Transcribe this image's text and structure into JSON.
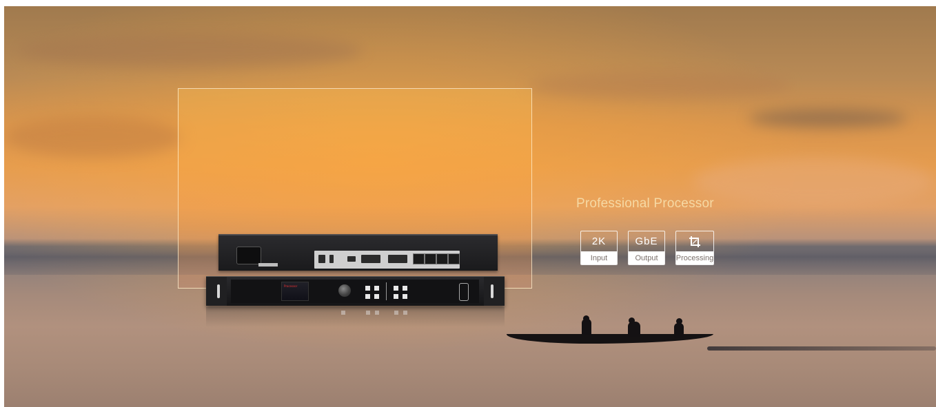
{
  "hero": {
    "headline": "Professional Processor",
    "features": [
      {
        "value": "2K",
        "label": "Input"
      },
      {
        "value": "GbE",
        "label": "Output"
      },
      {
        "icon": "crop-icon",
        "label": "Processing"
      }
    ]
  },
  "device": {
    "front_screen_brand": "Processor"
  },
  "colors": {
    "headline": "#f6d9a4",
    "badge_border": "#ffffff",
    "badge_label_text": "#7a6f6a"
  }
}
